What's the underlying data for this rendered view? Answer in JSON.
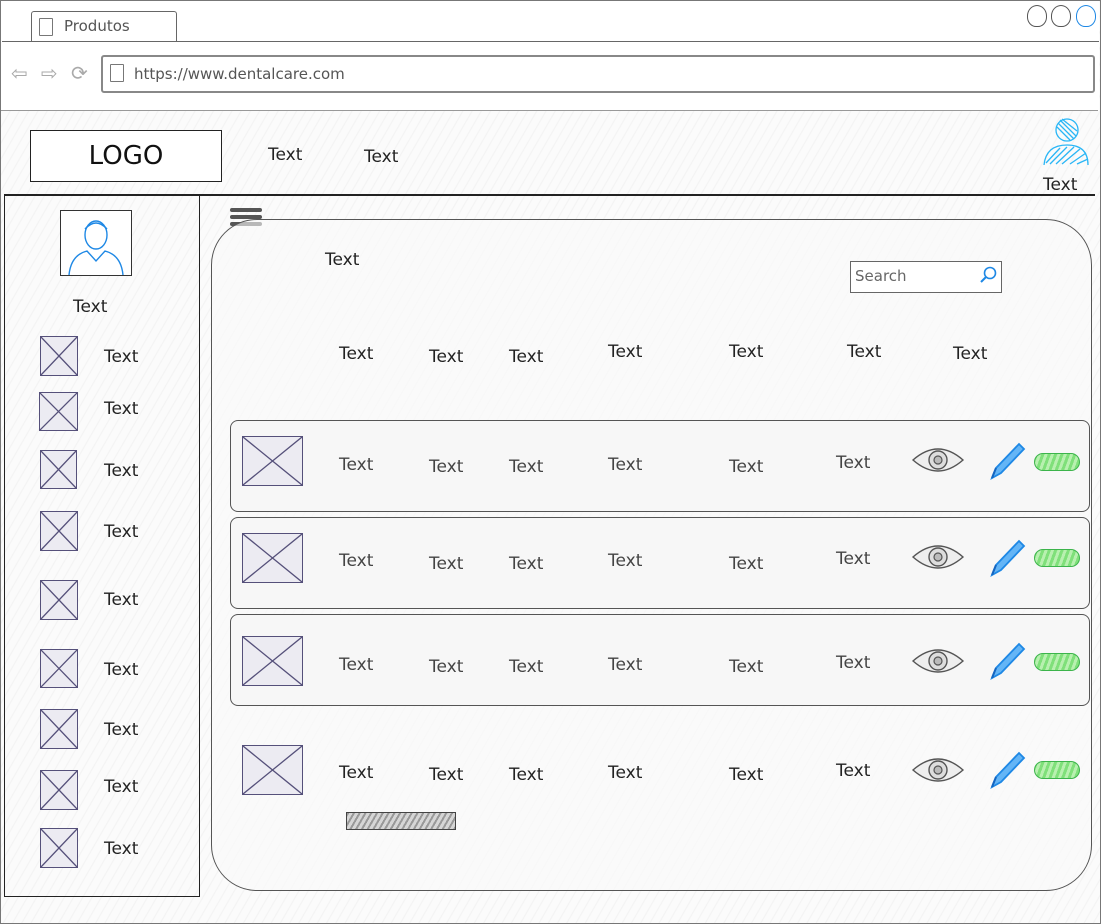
{
  "browser": {
    "tab_title": "Produtos",
    "url": "https://www.dentalcare.com"
  },
  "header": {
    "logo": "LOGO",
    "nav_items": [
      "Text",
      "Text"
    ],
    "user_label": "Text"
  },
  "sidebar": {
    "user_name": "Text",
    "items": [
      "Text",
      "Text",
      "Text",
      "Text",
      "Text",
      "Text",
      "Text",
      "Text",
      "Text"
    ]
  },
  "main": {
    "title": "Text",
    "search_placeholder": "Search",
    "columns": [
      "Text",
      "Text",
      "Text",
      "Text",
      "Text",
      "Text",
      "Text"
    ],
    "rows": [
      {
        "cells": [
          "Text",
          "Text",
          "Text",
          "Text",
          "Text",
          "Text"
        ]
      },
      {
        "cells": [
          "Text",
          "Text",
          "Text",
          "Text",
          "Text",
          "Text"
        ]
      },
      {
        "cells": [
          "Text",
          "Text",
          "Text",
          "Text",
          "Text",
          "Text"
        ]
      },
      {
        "cells": [
          "Text",
          "Text",
          "Text",
          "Text",
          "Text",
          "Text"
        ]
      }
    ],
    "progress": 1.0
  },
  "colors": {
    "accent_blue": "#1e88e5",
    "toggle_green": "#3cb44b",
    "placeholder": "#55507a"
  }
}
